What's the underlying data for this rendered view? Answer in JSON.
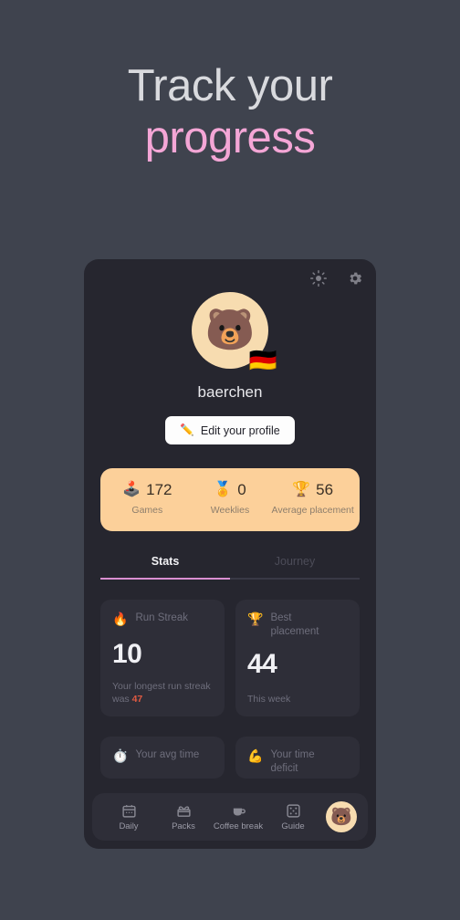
{
  "headline": {
    "line1": "Track your",
    "line2": "progress",
    "accent_color": "#f4a6d6"
  },
  "page": {
    "background_color": "#3f434e",
    "screen_background_color": "#26262f",
    "card_background_color": "#2e2e38"
  },
  "topbar": {
    "brightness_icon": "sun-icon",
    "settings_icon": "gear-icon"
  },
  "profile": {
    "avatar_emoji": "🐻",
    "flag_emoji": "🇩🇪",
    "username": "baerchen",
    "edit_button_emoji": "✏️",
    "edit_button_label": "Edit your profile"
  },
  "banner": {
    "background_color": "#fcd09a",
    "columns": [
      {
        "icon": "🕹️",
        "value": "172",
        "label": "Games"
      },
      {
        "icon": "🏅",
        "value": "0",
        "label": "Weeklies"
      },
      {
        "icon": "🏆",
        "value": "56",
        "label": "Average placement"
      }
    ]
  },
  "tabs": {
    "active_color": "#d98fd0",
    "items": [
      {
        "label": "Stats",
        "active": true
      },
      {
        "label": "Journey",
        "active": false
      }
    ]
  },
  "cards": [
    {
      "icon": "🔥",
      "title": "Run Streak",
      "value": "10",
      "footer_prefix": "Your longest run streak was ",
      "footer_highlight": "47",
      "highlight_color": "#e05a42"
    },
    {
      "icon": "🏆",
      "title": "Best placement",
      "value": "44",
      "footer_prefix": "This week",
      "footer_highlight": "",
      "highlight_color": "#e05a42"
    }
  ],
  "cards_partial": [
    {
      "icon": "⏱️",
      "title": "Your avg time"
    },
    {
      "icon": "💪",
      "title": "Your time deficit"
    }
  ],
  "nav": {
    "items": [
      {
        "label": "Daily",
        "icon": "calendar-icon"
      },
      {
        "label": "Packs",
        "icon": "gift-box-icon"
      },
      {
        "label": "Coffee break",
        "icon": "coffee-cup-icon"
      },
      {
        "label": "Guide",
        "icon": "dice-icon"
      }
    ],
    "avatar_emoji": "🐻"
  }
}
